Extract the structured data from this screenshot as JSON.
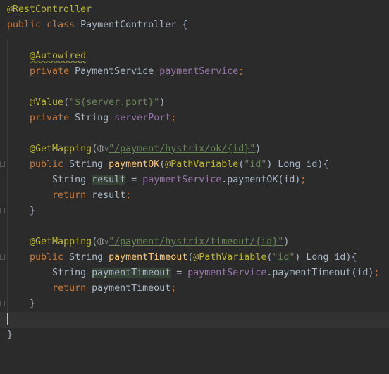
{
  "code": {
    "rest_controller_annotation": "@RestController",
    "kw_public": "public",
    "kw_class": "class",
    "class_name": "PaymentController",
    "brace_open": "{",
    "brace_close": "}",
    "autowired_annotation": "@Autowired",
    "kw_private": "private",
    "payment_service_type": "PaymentService",
    "payment_service_field": "paymentService",
    "semicolon": ";",
    "value_annotation": "@Value",
    "value_arg": "\"${server.port}\"",
    "string_type": "String",
    "server_port_field": "serverPort",
    "getmapping_annotation": "@GetMapping",
    "path_ok": "\"/payment/hystrix/ok/{id}\"",
    "method_ok": "paymentOK",
    "pathvariable_annotation": "@PathVariable",
    "id_literal": "\"id\"",
    "long_param": "Long id",
    "var_result": "result",
    "call_ok": "paymentOK(id)",
    "kw_return": "return",
    "path_timeout": "\"/payment/hystrix/timeout/{id}\"",
    "method_timeout": "paymentTimeout",
    "var_payment_timeout": "paymentTimeout",
    "call_timeout": "paymentTimeout(id)"
  }
}
